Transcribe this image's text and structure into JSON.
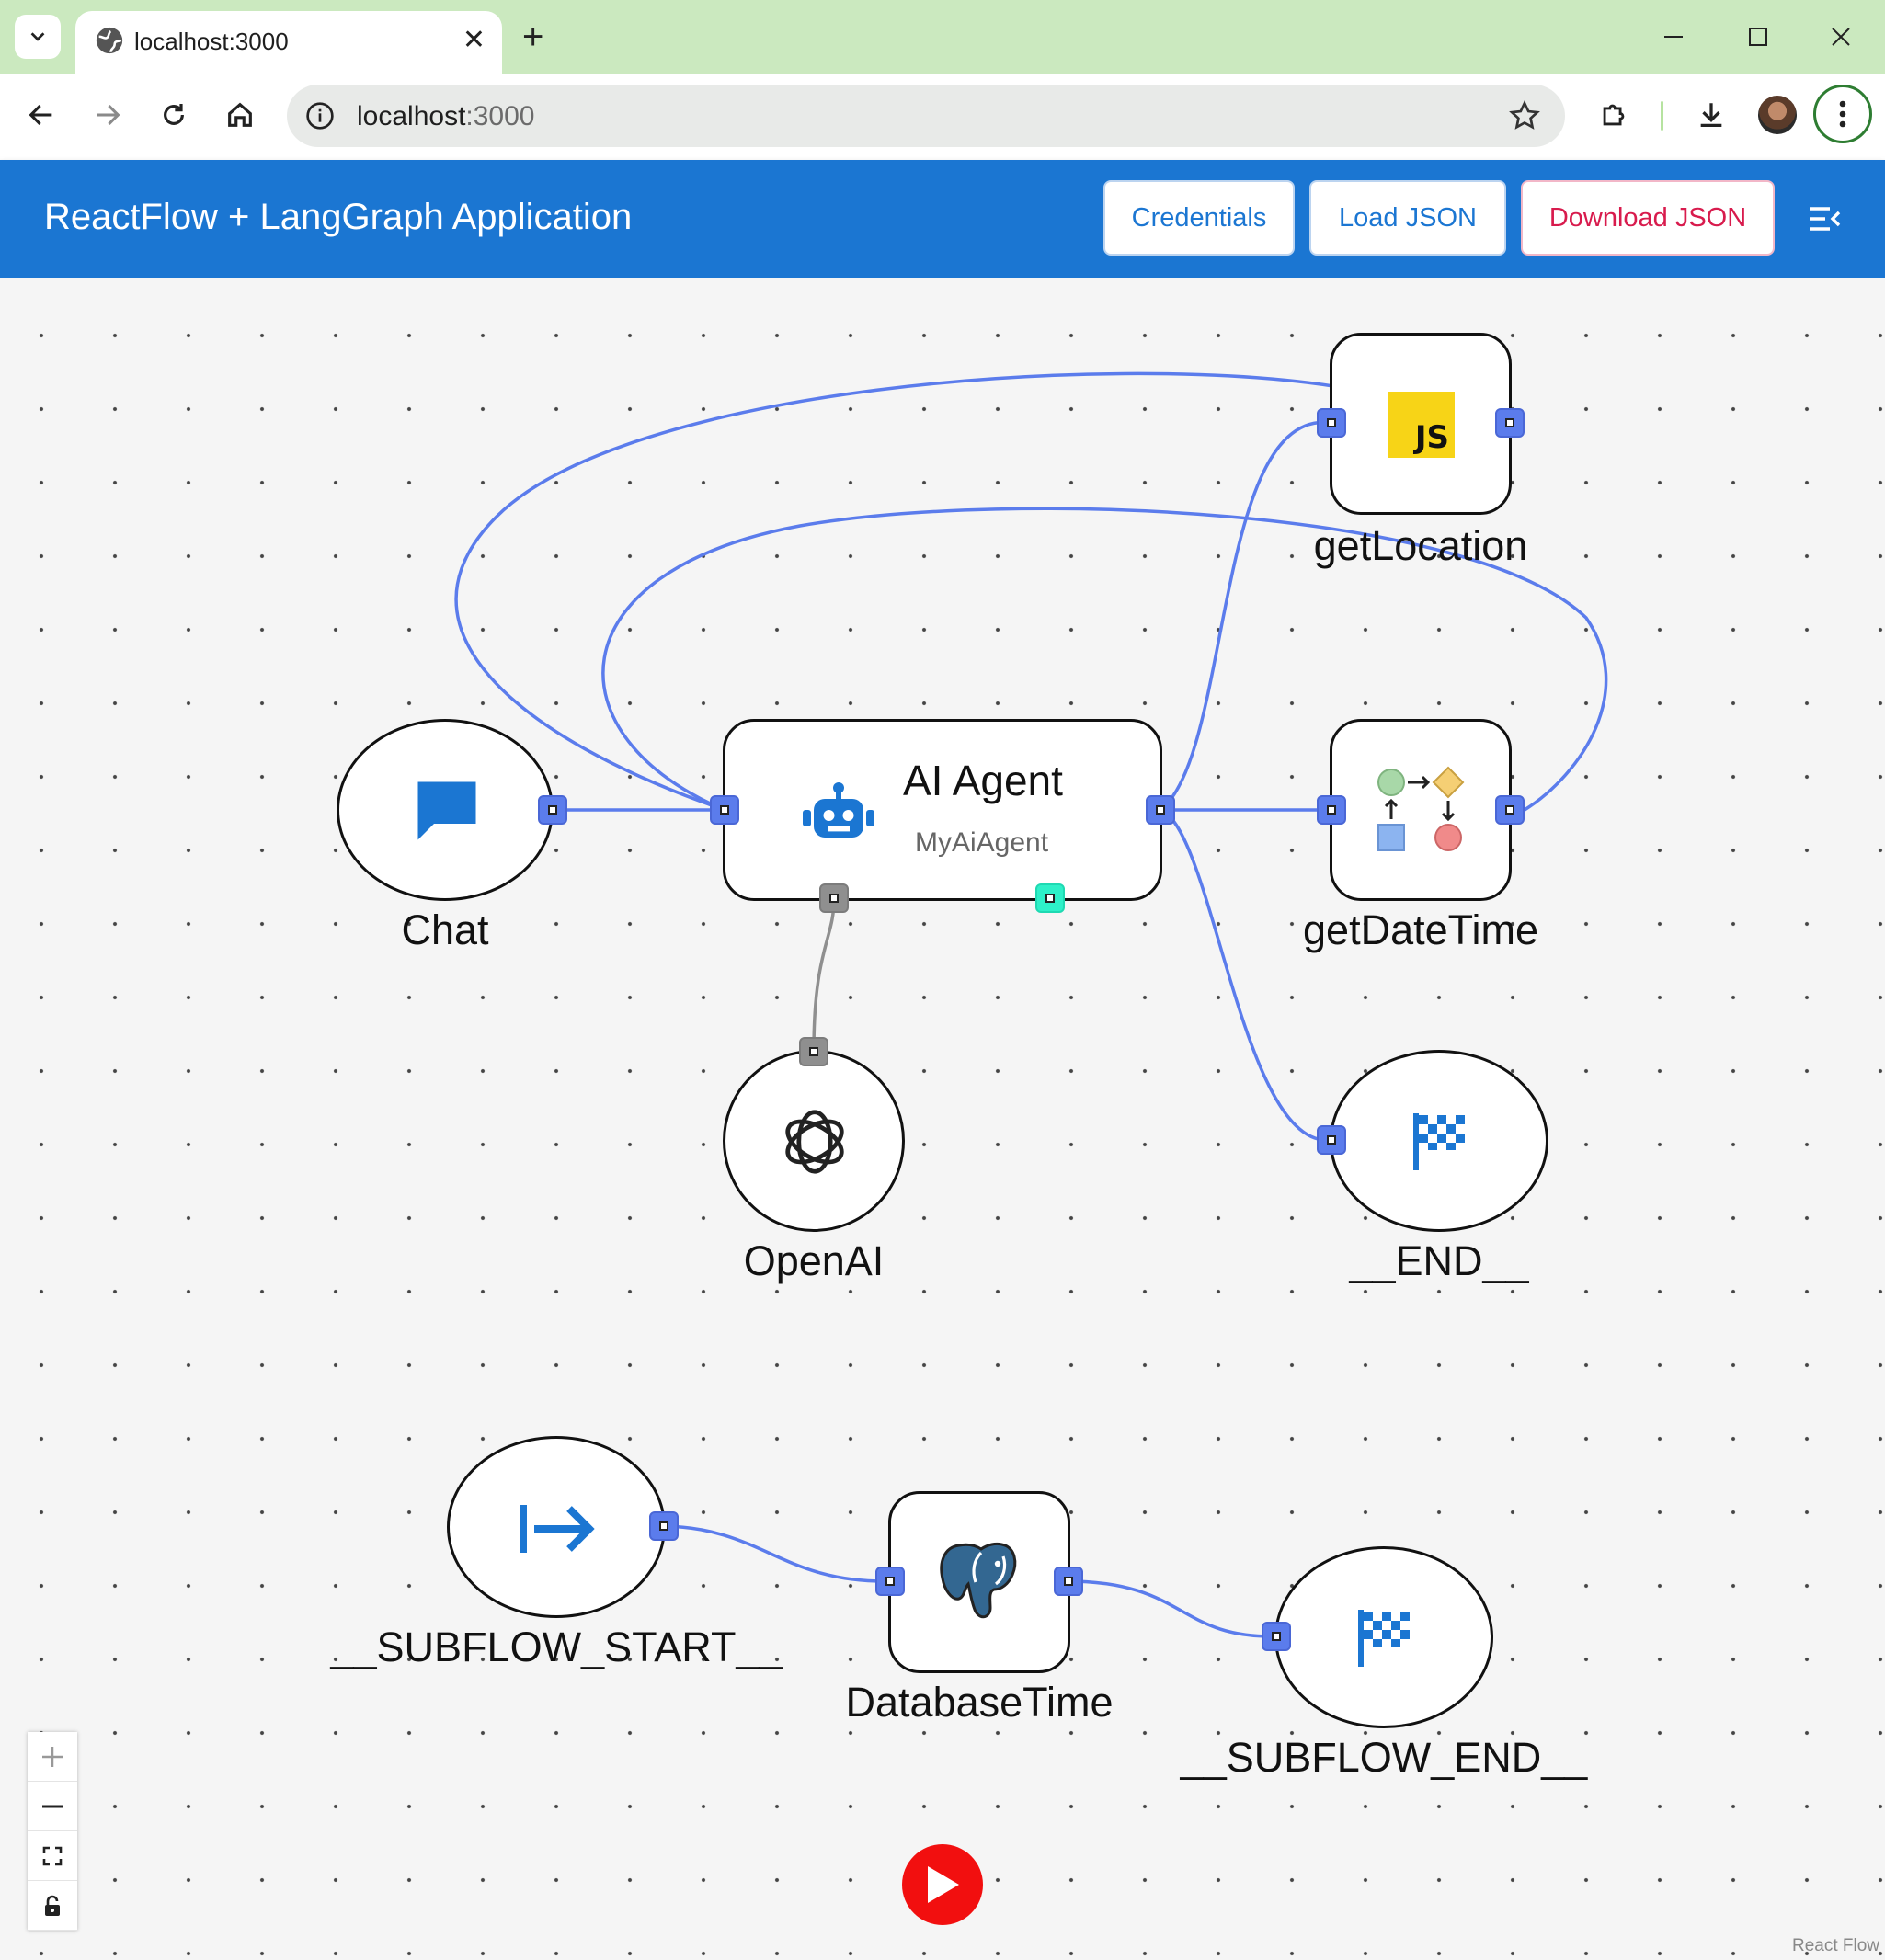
{
  "browser": {
    "tab_title": "localhost:3000",
    "url_host": "localhost",
    "url_port": ":3000"
  },
  "app": {
    "title": "ReactFlow + LangGraph Application",
    "buttons": {
      "credentials": "Credentials",
      "load_json": "Load JSON",
      "download_json": "Download JSON"
    }
  },
  "colors": {
    "header": "#1b76d2",
    "edge": "#5b7cec",
    "handle": "#5b7cec",
    "download_button_text": "#d81b4d",
    "run_button": "#f20f0f"
  },
  "nodes": {
    "chat": {
      "label": "Chat",
      "icon": "chat-bubble-icon"
    },
    "ai_agent": {
      "title": "AI Agent",
      "subtitle": "MyAiAgent",
      "icon": "robot-icon"
    },
    "get_location": {
      "label": "getLocation",
      "icon": "javascript-icon",
      "icon_text": "JS"
    },
    "get_date_time": {
      "label": "getDateTime",
      "icon": "flowchart-icon"
    },
    "openai": {
      "label": "OpenAI",
      "icon": "openai-icon"
    },
    "end": {
      "label": "__END__",
      "icon": "checkered-flag-icon"
    },
    "subflow_start": {
      "label": "__SUBFLOW_START__",
      "icon": "arrow-right-to-bar-icon"
    },
    "database_time": {
      "label": "DatabaseTime",
      "icon": "postgresql-icon"
    },
    "subflow_end": {
      "label": "__SUBFLOW_END__",
      "icon": "checkered-flag-icon"
    }
  },
  "controls": [
    "zoom-in-icon",
    "zoom-out-icon",
    "fit-view-icon",
    "lock-icon"
  ],
  "attribution": "React Flow"
}
